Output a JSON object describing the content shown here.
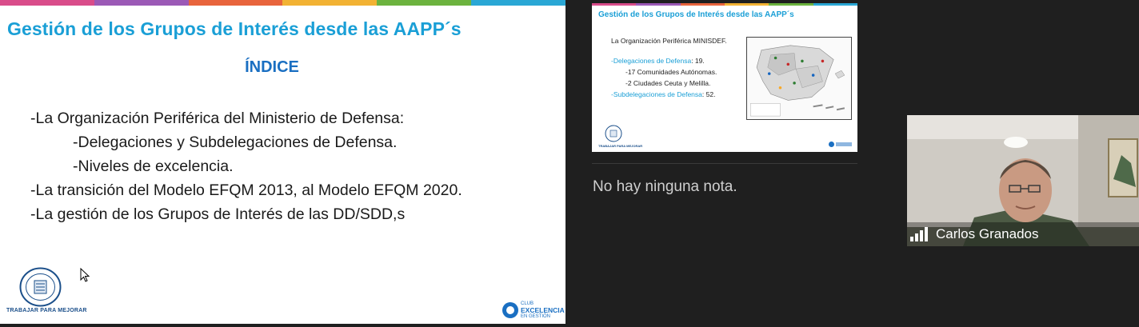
{
  "main_slide": {
    "title": "Gestión de los Grupos de Interés desde las AAPP´s",
    "index_heading": "ÍNDICE",
    "bullets": {
      "b1": "-La Organización Periférica del Ministerio de Defensa:",
      "b1a": "-Delegaciones y Subdelegaciones de Defensa.",
      "b1b": "-Niveles de excelencia.",
      "b2": "-La transición del Modelo EFQM 2013, al Modelo EFQM 2020.",
      "b3": "-La gestión de los Grupos de Interés de las DD/SDD,s"
    },
    "footer_left": "TRABAJAR PARA MEJORAR",
    "club_logo": {
      "l1": "CLUB",
      "l2": "EXCELENCIA",
      "l3": "EN GESTIÓN"
    },
    "stripe_colors": [
      "#d94c8a",
      "#9b59b6",
      "#e8643c",
      "#f2b233",
      "#6cb33f",
      "#2aa7d5"
    ]
  },
  "thumbnail": {
    "title": "Gestión de los Grupos de Interés desde las AAPP´s",
    "line1": "La Organización Periférica MINISDEF.",
    "line2_label": "-Delegaciones de Defensa",
    "line2_value": ": 19.",
    "line3": "-17 Comunidades Autónomas.",
    "line4": "-2 Ciudades Ceuta y Melilla.",
    "line5_label": "-Subdelegaciones de Defensa",
    "line5_value": ": 52.",
    "footer_left": "TRABAJAR PARA MEJORAR"
  },
  "notes": {
    "empty_text": "No hay ninguna nota."
  },
  "video": {
    "participant_name": "Carlos Granados",
    "signal_icon": "signal-bars-icon"
  },
  "colors": {
    "title_blue": "#1a9fd6",
    "index_blue": "#1a6fc2",
    "panel_bg": "#1f1f1f"
  }
}
